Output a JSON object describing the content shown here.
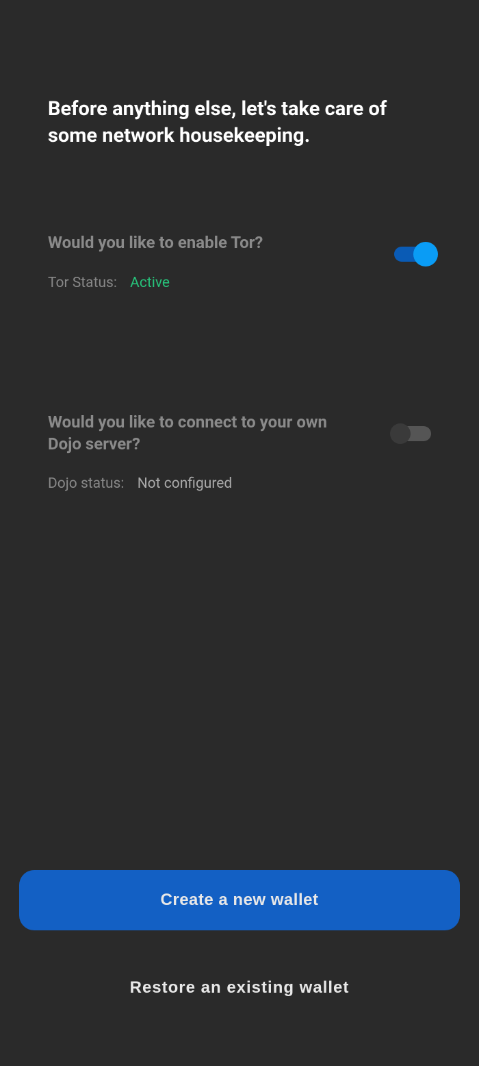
{
  "heading": "Before anything else, let's take care of some network housekeeping.",
  "tor": {
    "question": "Would you like to enable Tor?",
    "status_label": "Tor Status:",
    "status_value": "Active",
    "enabled": true
  },
  "dojo": {
    "question": "Would you like to connect to your own Dojo server?",
    "status_label": "Dojo status:",
    "status_value": "Not configured",
    "enabled": false
  },
  "buttons": {
    "create": "Create a new wallet",
    "restore": "Restore an existing wallet"
  }
}
